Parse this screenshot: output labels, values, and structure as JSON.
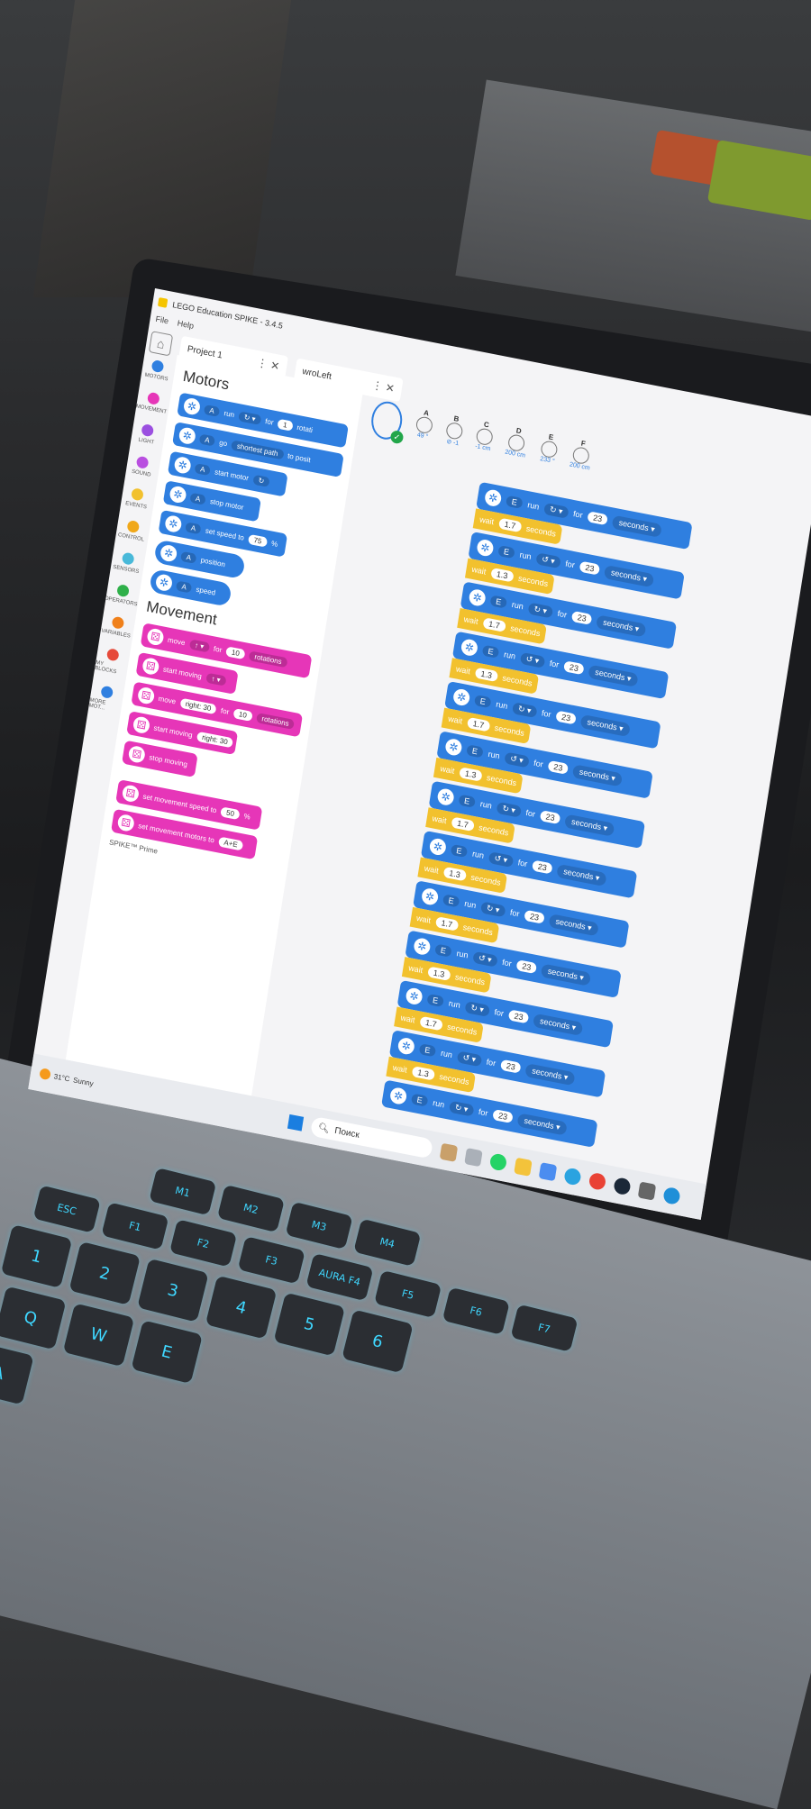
{
  "app": {
    "title": "LEGO Education SPIKE - 3.4.5",
    "menu": [
      "File",
      "Help"
    ],
    "tabs": [
      {
        "label": "Project 1"
      },
      {
        "label": "wroLeft"
      }
    ]
  },
  "categories": [
    {
      "label": "MOTORS",
      "color": "#2f7fe0"
    },
    {
      "label": "MOVEMENT",
      "color": "#e636b8"
    },
    {
      "label": "LIGHT",
      "color": "#9b4fe0"
    },
    {
      "label": "SOUND",
      "color": "#b94fe0"
    },
    {
      "label": "EVENTS",
      "color": "#f2c12e"
    },
    {
      "label": "CONTROL",
      "color": "#f0a81a"
    },
    {
      "label": "SENSORS",
      "color": "#49b9d9"
    },
    {
      "label": "OPERATORS",
      "color": "#2fb04a"
    },
    {
      "label": "VARIABLES",
      "color": "#f0801a"
    },
    {
      "label": "MY BLOCKS",
      "color": "#e64a3a"
    },
    {
      "label": "MORE MOT...",
      "color": "#2f7fe0"
    }
  ],
  "palette": {
    "motors_title": "Motors",
    "motors": {
      "run": {
        "port": "A",
        "verb": "run",
        "for": "for",
        "value": "1",
        "unit": "rotati"
      },
      "go": {
        "port": "A",
        "verb": "go",
        "mode": "shortest path",
        "tail": "to posit"
      },
      "start": {
        "port": "A",
        "label": "start motor"
      },
      "stop": {
        "port": "A",
        "label": "stop motor"
      },
      "speed": {
        "port": "A",
        "label": "set speed to",
        "value": "75",
        "unit": "%"
      },
      "position": {
        "port": "A",
        "label": "position"
      },
      "speed_reporter": {
        "port": "A",
        "label": "speed"
      }
    },
    "movement_title": "Movement",
    "movement": {
      "move": {
        "label": "move",
        "for": "for",
        "value": "10",
        "unit": "rotations"
      },
      "start_moving": {
        "label": "start moving"
      },
      "move_steer": {
        "label": "move",
        "dir": "right: 30",
        "for": "for",
        "value": "10",
        "unit": "rotations"
      },
      "start_moving_steer": {
        "label": "start moving",
        "dir": "right: 30"
      },
      "stop_moving": {
        "label": "stop moving"
      },
      "set_speed": {
        "label": "set movement speed to",
        "value": "50",
        "unit": "%"
      },
      "set_motors": {
        "label": "set movement motors to",
        "value": "A+E"
      }
    },
    "footer": "SPIKE™ Prime"
  },
  "hub": {
    "ports": [
      {
        "label": "A",
        "value": "49 °"
      },
      {
        "label": "B",
        "value": "⊘ -1"
      },
      {
        "label": "C",
        "value": "-1 cm"
      },
      {
        "label": "D",
        "value": "200 cm"
      },
      {
        "label": "E",
        "value": "233 °"
      },
      {
        "label": "F",
        "value": "200 cm"
      }
    ]
  },
  "program": {
    "run_block": {
      "port": "E",
      "verb": "run",
      "for": "for",
      "value": "23",
      "unit": "seconds"
    },
    "waits": [
      "1.7",
      "1.3",
      "1.7",
      "1.3",
      "1.7",
      "1.3",
      "1.7",
      "1.3",
      "1.7",
      "1.3",
      "1.7",
      "1.3"
    ],
    "wait_label": "wait",
    "wait_unit": "seconds"
  },
  "taskbar": {
    "weather_temp": "31°C",
    "weather_desc": "Sunny",
    "search_placeholder": "Поиск"
  },
  "keyboard": {
    "row_fn": [
      "M1",
      "M2",
      "M3",
      "M4"
    ],
    "row1": [
      "ESC",
      "F1",
      "F2",
      "F3",
      "AURA F4",
      "F5",
      "F6",
      "F7"
    ],
    "row2": [
      "1",
      "2",
      "3",
      "4",
      "5",
      "6"
    ],
    "row3": [
      "Q",
      "W",
      "E"
    ],
    "row4": [
      "A"
    ]
  }
}
